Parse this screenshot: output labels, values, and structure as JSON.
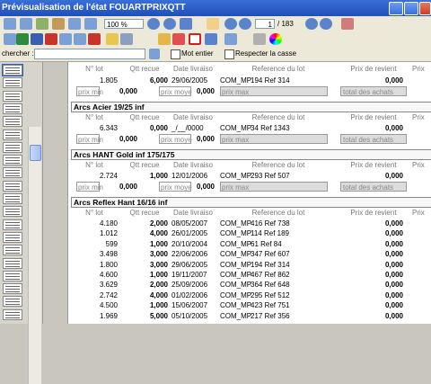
{
  "window": {
    "title": "Prévisualisation de l'état FOUARTPRIXQTT"
  },
  "toolbar": {
    "zoom_value": "100 %",
    "page_current": "1",
    "page_total": "/ 183"
  },
  "search": {
    "label": "chercher :",
    "not_whole_label": "Mot entier",
    "match_case_label": "Respecter la casse"
  },
  "report": {
    "columns": {
      "lot": "N° lot",
      "qtt": "Qtt recue",
      "date": "Date livraiso",
      "ref": "Reference du lot",
      "prix": "Prix de revient",
      "prix2": "Prix"
    },
    "summary_labels": {
      "min": "prix min",
      "moyen": "prix moye",
      "max": "prix max",
      "total": "total des achats"
    },
    "top_row": {
      "lot": "1.805",
      "qtt": "6,000",
      "date": "29/06/2005",
      "ref1": "COM_MP",
      "ref2": "194 Ref 314",
      "prix": "0,000",
      "min": "0,000",
      "moyen": "0,000"
    },
    "sections": [
      {
        "title": "Arcs Acier 19/25 inf",
        "lot": "6.343",
        "qtt": "0,000",
        "date": "_/__/0000",
        "ref1": "COM_MP",
        "ref2": "34 Ref 1343",
        "prix": "0,000",
        "min": "0,000",
        "moyen": "0,000"
      },
      {
        "title": "Arcs HANT Gold inf 175/175",
        "lot": "2.724",
        "qtt": "1,000",
        "date": "12/01/2006",
        "ref1": "COM_MP",
        "ref2": "293 Ref 507",
        "prix": "0,000",
        "min": "0,000",
        "moyen": "0,000"
      },
      {
        "title": "Arcs Reflex Hant 16/16 inf"
      }
    ],
    "reflex_rows": [
      {
        "lot": "4.180",
        "qtt": "2,000",
        "date": "08/05/2007",
        "ref1": "COM_MP",
        "ref2": "416 Ref 738",
        "prix": "0,000"
      },
      {
        "lot": "1.012",
        "qtt": "4,000",
        "date": "26/01/2005",
        "ref1": "COM_MP",
        "ref2": "114 Ref 189",
        "prix": "0,000"
      },
      {
        "lot": "599",
        "qtt": "1,000",
        "date": "20/10/2004",
        "ref1": "COM_MP",
        "ref2": "61 Ref 84",
        "prix": "0,000"
      },
      {
        "lot": "3.498",
        "qtt": "3,000",
        "date": "22/06/2006",
        "ref1": "COM_MP",
        "ref2": "347 Ref 607",
        "prix": "0,000"
      },
      {
        "lot": "1.800",
        "qtt": "3,000",
        "date": "29/06/2005",
        "ref1": "COM_MP",
        "ref2": "194 Ref 314",
        "prix": "0,000"
      },
      {
        "lot": "4.600",
        "qtt": "1,000",
        "date": "19/11/2007",
        "ref1": "COM_MP",
        "ref2": "467 Ref 862",
        "prix": "0,000"
      },
      {
        "lot": "3.629",
        "qtt": "2,000",
        "date": "25/09/2006",
        "ref1": "COM_MP",
        "ref2": "364 Ref 648",
        "prix": "0,000"
      },
      {
        "lot": "2.742",
        "qtt": "4,000",
        "date": "01/02/2006",
        "ref1": "COM_MP",
        "ref2": "295 Ref 512",
        "prix": "0,000"
      },
      {
        "lot": "4.500",
        "qtt": "1,000",
        "date": "15/06/2007",
        "ref1": "COM_MP",
        "ref2": "423 Ref 751",
        "prix": "0,000"
      },
      {
        "lot": "1.969",
        "qtt": "5,000",
        "date": "05/10/2005",
        "ref1": "COM_MP",
        "ref2": "217 Ref 356",
        "prix": "0,000"
      }
    ]
  },
  "colors": {
    "titlebar": "#2a5fcf",
    "toolbar": "#ece9d8",
    "sidebar": "#d7d4cc"
  },
  "icons": [
    "zoom-in-icon",
    "zoom-out-icon",
    "hand-icon",
    "first-page-icon",
    "prev-page-icon",
    "next-page-icon",
    "last-page-icon",
    "print-icon",
    "excel-icon",
    "word-icon",
    "pdf-icon",
    "email-icon",
    "pencil-icon",
    "line-icon",
    "rectangle-icon",
    "color-icon"
  ]
}
